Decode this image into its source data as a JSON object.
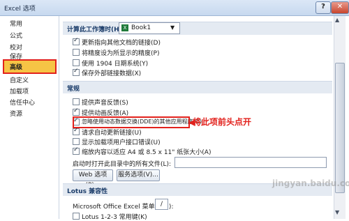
{
  "window": {
    "title": "Excel 选项",
    "help_label": "?",
    "close_label": "✕"
  },
  "sidebar": {
    "items": [
      {
        "label": "常用"
      },
      {
        "label": "公式"
      },
      {
        "label": "校对"
      },
      {
        "label": "保存"
      },
      {
        "label": "高级",
        "selected": true
      },
      {
        "label": "自定义"
      },
      {
        "label": "加载项"
      },
      {
        "label": "信任中心"
      },
      {
        "label": "资源"
      }
    ]
  },
  "workbook_section": {
    "title": "计算此工作簿时(H):",
    "select_value": "Book1",
    "options": [
      {
        "label": "更新指向其他文档的链接(D)",
        "checked": true
      },
      {
        "label": "将精度设为所显示的精度(P)",
        "checked": false
      },
      {
        "label": "使用 1904 日期系统(Y)",
        "checked": false
      },
      {
        "label": "保存外部链接数据(X)",
        "checked": true
      }
    ]
  },
  "general_section": {
    "title": "常规",
    "options": [
      {
        "label": "提供声音反馈(S)",
        "checked": false
      },
      {
        "label": "提供动画反馈(A)",
        "checked": true
      },
      {
        "label": "忽略使用动态数据交换(DDE)的其他应用程序(O)",
        "checked": true
      },
      {
        "label": "请求自动更新链接(U)",
        "checked": true
      },
      {
        "label": "显示加载项用户接口错误(U)",
        "checked": false
      },
      {
        "label": "缩放内容以适应 A4 或 8.5 x 11\" 纸张大小(A)",
        "checked": true
      }
    ],
    "startup_label": "启动时打开此目录中的所有文件(L):",
    "startup_value": "",
    "web_options_button": "Web 选项(P)...",
    "service_options_button": "服务选项(V)..."
  },
  "lotus_section": {
    "title": "Lotus 兼容性",
    "menu_key_label": "Microsoft Office Excel 菜单键(M):",
    "menu_key_value": "/",
    "options": [
      {
        "label": "Lotus 1-2-3 常用键(K)",
        "checked": false
      }
    ]
  },
  "annotation": {
    "text": "将此项前头点开",
    "arrow": "◀"
  },
  "watermark": "jingyan.baidu.com"
}
